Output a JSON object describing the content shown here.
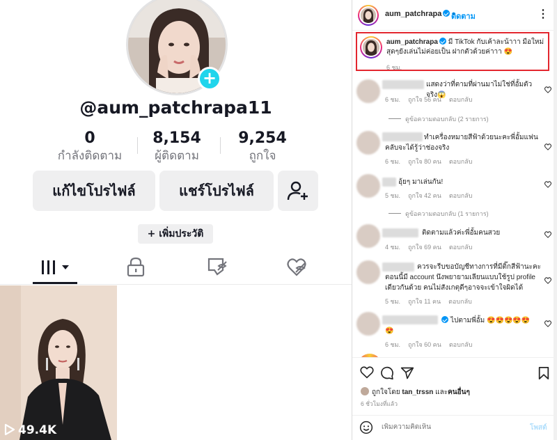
{
  "tiktok": {
    "username": "@aum_patchrapa11",
    "stats": [
      {
        "value": "0",
        "label": "กำลังติดตาม"
      },
      {
        "value": "8,154",
        "label": "ผู้ติดตาม"
      },
      {
        "value": "9,254",
        "label": "ถูกใจ"
      }
    ],
    "edit_profile_label": "แก้ไขโปรไฟล์",
    "share_profile_label": "แชร์โปรไฟล์",
    "add_bio_label": "+ เพิ่มประวัติ",
    "tabs": [
      "videos-tab",
      "private-tab",
      "reposts-tab",
      "liked-tab"
    ],
    "video_views": "49.4K",
    "accent_color": "#20d5ec"
  },
  "instagram": {
    "header_username": "aum_patchrapa",
    "follow_separator": "•",
    "follow_label": "ติดตาม",
    "caption": {
      "username": "aum_patchrapa",
      "text": "มี TikTok กับเค้าละน้าาา มือใหม่สุดๆยังเล่นไม่ค่อยเป็น ฝากตัวด้วยค่าาา 😍",
      "time": "6 ชม."
    },
    "comments": [
      {
        "text": "แสดงว่าที่ตามที่ผ่านมาไม่ใช่ที่อั้มตัวจริง😱",
        "time": "6 ชม.",
        "likes": "ถูกใจ 56 คน",
        "reply": "ตอบกลับ",
        "replies": "ดูข้อความตอบกลับ (2 รายการ)"
      },
      {
        "text": "ทำเครื่องหมายสีฟ้าด้วยนะคะพี่อั้มแฟนคลับจะได้รู้ว่าช่องจริง",
        "time": "6 ชม.",
        "likes": "ถูกใจ 80 คน",
        "reply": "ตอบกลับ"
      },
      {
        "text": "อุ้ยๆ มาเล่นกัน!",
        "time": "5 ชม.",
        "likes": "ถูกใจ 42 คน",
        "reply": "ตอบกลับ",
        "replies": "ดูข้อความตอบกลับ (1 รายการ)"
      },
      {
        "text": "ติดตามแล้วค่ะพี่อั้มคนสวย",
        "time": "4 ชม.",
        "likes": "ถูกใจ 69 คน",
        "reply": "ตอบกลับ"
      },
      {
        "text": "ควรจะรีบขอบัญชีทางการที่มีติ๊กสีฟ้านะคะ ตอนนี้มี account นึงพยายามเลียนแบบใช้รูป profile เดียวกันด้วย คนไม่สังเกตุดีๆอาจจะเข้าใจผิดได้",
        "time": "5 ชม.",
        "likes": "ถูกใจ 11 คน",
        "reply": "ตอบกลับ"
      },
      {
        "text": "ไปตามพี่อั้ม 😍😍😍😍😍",
        "text2": "😍",
        "time": "6 ชม.",
        "likes": "ถูกใจ 60 คน",
        "reply": "ตอบกลับ"
      }
    ],
    "liked_by_prefix": "ถูกใจโดย",
    "liked_by_user": "tan_trssn",
    "liked_by_and": "และ",
    "liked_by_others": "คนอื่นๆ",
    "post_time": "6 ชั่วโมงที่แล้ว",
    "comment_placeholder": "เพิ่มความคิดเห็น",
    "post_label": "โพสต์",
    "highlight_color": "#e3262e",
    "link_color": "#0095f6"
  }
}
